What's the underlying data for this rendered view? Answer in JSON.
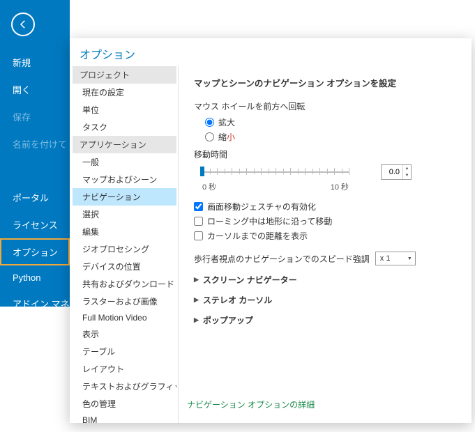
{
  "ribbon": {
    "items": [
      {
        "label": "新規",
        "disabled": false
      },
      {
        "label": "開く",
        "disabled": false
      },
      {
        "label": "保存",
        "disabled": true
      },
      {
        "label": "名前を付けて",
        "disabled": true
      }
    ],
    "items2": [
      {
        "label": "ポータル"
      },
      {
        "label": "ライセンス"
      },
      {
        "label": "オプション",
        "active": true
      },
      {
        "label": "Python"
      },
      {
        "label": "アドイン マネー"
      }
    ]
  },
  "dialog": {
    "title": "オプション",
    "categories": {
      "group1_header": "プロジェクト",
      "group1": [
        "現在の設定",
        "単位",
        "タスク"
      ],
      "group2_header": "アプリケーション",
      "group2": [
        "一般",
        "マップおよびシーン",
        "ナビゲーション",
        "選択",
        "編集",
        "ジオプロセシング",
        "デバイスの位置",
        "共有およびダウンロード",
        "ラスターおよび画像",
        "Full Motion Video",
        "表示",
        "テーブル",
        "レイアウト",
        "テキストおよびグラフィックス",
        "色の管理",
        "BIM"
      ],
      "selected": "ナビゲーション"
    }
  },
  "content": {
    "heading": "マップとシーンのナビゲーション オプションを設定",
    "wheel_label": "マウス ホイールを前方へ回転",
    "radio_zoom_in": "拡大",
    "radio_zoom_out_prefix": "縮",
    "radio_zoom_out_suffix": "小",
    "transition_label": "移動時間",
    "slider_min": "0 秒",
    "slider_max": "10 秒",
    "slider_value": "0.0",
    "chk_gesture": "画面移動ジェスチャの有効化",
    "chk_roaming": "ローミング中は地形に沿って移動",
    "chk_cursor": "カーソルまでの距離を表示",
    "speed_label": "歩行者視点のナビゲーションでのスピード強調",
    "speed_value": "x 1",
    "exp_screen": "スクリーン ナビゲーター",
    "exp_stereo": "ステレオ カーソル",
    "exp_popup": "ポップアップ",
    "footer": "ナビゲーション オプションの詳細"
  }
}
